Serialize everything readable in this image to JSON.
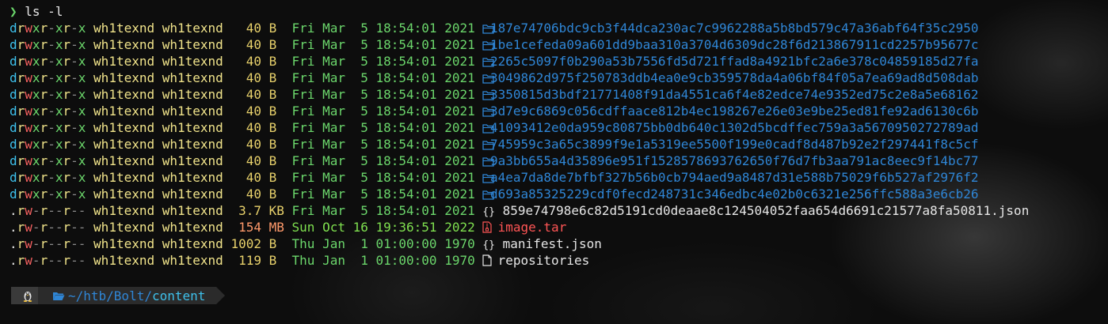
{
  "command": {
    "prompt_symbol": "❯",
    "text": "ls -l"
  },
  "listing": [
    {
      "perms": "drwxr-xr-x",
      "owner": "wh1texnd",
      "group": "wh1texnd",
      "size": "40",
      "unit": "B",
      "date": "Fri Mar  5 18:54:01 2021",
      "icon": "folder-icon",
      "name": "187e74706bdc9cb3f44dca230ac7c9962288a5b8bd579c47a36abf64f35c2950",
      "kind": "dir"
    },
    {
      "perms": "drwxr-xr-x",
      "owner": "wh1texnd",
      "group": "wh1texnd",
      "size": "40",
      "unit": "B",
      "date": "Fri Mar  5 18:54:01 2021",
      "icon": "folder-icon",
      "name": "1be1cefeda09a601dd9baa310a3704d6309dc28f6d213867911cd2257b95677c",
      "kind": "dir"
    },
    {
      "perms": "drwxr-xr-x",
      "owner": "wh1texnd",
      "group": "wh1texnd",
      "size": "40",
      "unit": "B",
      "date": "Fri Mar  5 18:54:01 2021",
      "icon": "folder-icon",
      "name": "2265c5097f0b290a53b7556fd5d721ffad8a4921bfc2a6e378c04859185d27fa",
      "kind": "dir"
    },
    {
      "perms": "drwxr-xr-x",
      "owner": "wh1texnd",
      "group": "wh1texnd",
      "size": "40",
      "unit": "B",
      "date": "Fri Mar  5 18:54:01 2021",
      "icon": "folder-icon",
      "name": "3049862d975f250783ddb4ea0e9cb359578da4a06bf84f05a7ea69ad8d508dab",
      "kind": "dir"
    },
    {
      "perms": "drwxr-xr-x",
      "owner": "wh1texnd",
      "group": "wh1texnd",
      "size": "40",
      "unit": "B",
      "date": "Fri Mar  5 18:54:01 2021",
      "icon": "folder-icon",
      "name": "3350815d3bdf21771408f91da4551ca6f4e82edce74e9352ed75c2e8a5e68162",
      "kind": "dir"
    },
    {
      "perms": "drwxr-xr-x",
      "owner": "wh1texnd",
      "group": "wh1texnd",
      "size": "40",
      "unit": "B",
      "date": "Fri Mar  5 18:54:01 2021",
      "icon": "folder-icon",
      "name": "3d7e9c6869c056cdffaace812b4ec198267e26e03e9be25ed81fe92ad6130c6b",
      "kind": "dir"
    },
    {
      "perms": "drwxr-xr-x",
      "owner": "wh1texnd",
      "group": "wh1texnd",
      "size": "40",
      "unit": "B",
      "date": "Fri Mar  5 18:54:01 2021",
      "icon": "folder-icon",
      "name": "41093412e0da959c80875bb0db640c1302d5bcdffec759a3a5670950272789ad",
      "kind": "dir"
    },
    {
      "perms": "drwxr-xr-x",
      "owner": "wh1texnd",
      "group": "wh1texnd",
      "size": "40",
      "unit": "B",
      "date": "Fri Mar  5 18:54:01 2021",
      "icon": "folder-icon",
      "name": "745959c3a65c3899f9e1a5319ee5500f199e0cadf8d487b92e2f297441f8c5cf",
      "kind": "dir"
    },
    {
      "perms": "drwxr-xr-x",
      "owner": "wh1texnd",
      "group": "wh1texnd",
      "size": "40",
      "unit": "B",
      "date": "Fri Mar  5 18:54:01 2021",
      "icon": "folder-icon",
      "name": "9a3bb655a4d35896e951f1528578693762650f76d7fb3aa791ac8eec9f14bc77",
      "kind": "dir"
    },
    {
      "perms": "drwxr-xr-x",
      "owner": "wh1texnd",
      "group": "wh1texnd",
      "size": "40",
      "unit": "B",
      "date": "Fri Mar  5 18:54:01 2021",
      "icon": "folder-icon",
      "name": "a4ea7da8de7bfbf327b56b0cb794aed9a8487d31e588b75029f6b527af2976f2",
      "kind": "dir"
    },
    {
      "perms": "drwxr-xr-x",
      "owner": "wh1texnd",
      "group": "wh1texnd",
      "size": "40",
      "unit": "B",
      "date": "Fri Mar  5 18:54:01 2021",
      "icon": "folder-icon",
      "name": "d693a85325229cdf0fecd248731c346edbc4e02b0c6321e256ffc588a3e6cb26",
      "kind": "dir"
    },
    {
      "perms": ".rw-r--r--",
      "owner": "wh1texnd",
      "group": "wh1texnd",
      "size": "3.7",
      "unit": "KB",
      "date": "Fri Mar  5 18:54:01 2021",
      "icon": "json-icon",
      "name": "859e74798e6c82d5191cd0deaae8c124504052faa654d6691c21577a8fa50811.json",
      "kind": "json"
    },
    {
      "perms": ".rw-r--r--",
      "owner": "wh1texnd",
      "group": "wh1texnd",
      "size": "154",
      "unit": "MB",
      "date": "Sun Oct 16 19:36:51 2022",
      "icon": "archive-icon",
      "name": "image.tar",
      "kind": "tar"
    },
    {
      "perms": ".rw-r--r--",
      "owner": "wh1texnd",
      "group": "wh1texnd",
      "size": "1002",
      "unit": "B",
      "date": "Thu Jan  1 01:00:00 1970",
      "icon": "json-icon",
      "name": "manifest.json",
      "kind": "json"
    },
    {
      "perms": ".rw-r--r--",
      "owner": "wh1texnd",
      "group": "wh1texnd",
      "size": "119",
      "unit": "B",
      "date": "Thu Jan  1 01:00:00 1970",
      "icon": "file-icon",
      "name": "repositories",
      "kind": "file"
    }
  ],
  "prompt": {
    "os_icon": "linux-icon",
    "path_prefix": "~/htb/Bolt/",
    "path_current": "content"
  },
  "colors": {
    "dir": "#2f86d6",
    "tar": "#ff5555",
    "date": "#6bd66b",
    "owner": "#f0e38a"
  }
}
